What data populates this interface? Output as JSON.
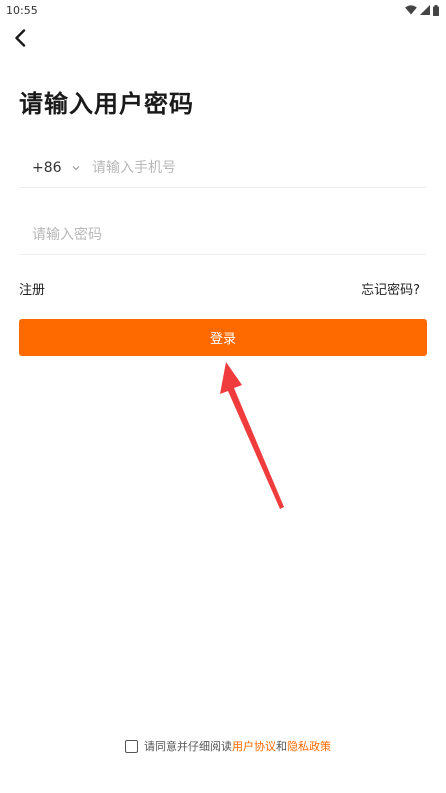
{
  "status_bar": {
    "time": "10:55",
    "icons": [
      "wifi-icon",
      "signal-icon",
      "battery-icon"
    ]
  },
  "header": {
    "back_icon": "chevron-left-icon",
    "title": "请输入用户密码"
  },
  "form": {
    "country_code": "+86",
    "country_chevron_icon": "chevron-down-icon",
    "phone_placeholder": "请输入手机号",
    "phone_value": "",
    "password_placeholder": "请输入密码",
    "password_value": ""
  },
  "links": {
    "register": "注册",
    "forgot_password": "忘记密码?"
  },
  "login_button": {
    "label": "登录"
  },
  "annotation": {
    "arrow_color": "#f03c3c"
  },
  "agreement": {
    "checked": false,
    "prefix": "请同意并仔细阅读",
    "user_agreement": "用户协议",
    "and": "和",
    "privacy_policy": "隐私政策"
  },
  "colors": {
    "accent": "#ff6a00",
    "text": "#222222",
    "placeholder": "#b8b8b8",
    "divider": "#eeeeee"
  }
}
